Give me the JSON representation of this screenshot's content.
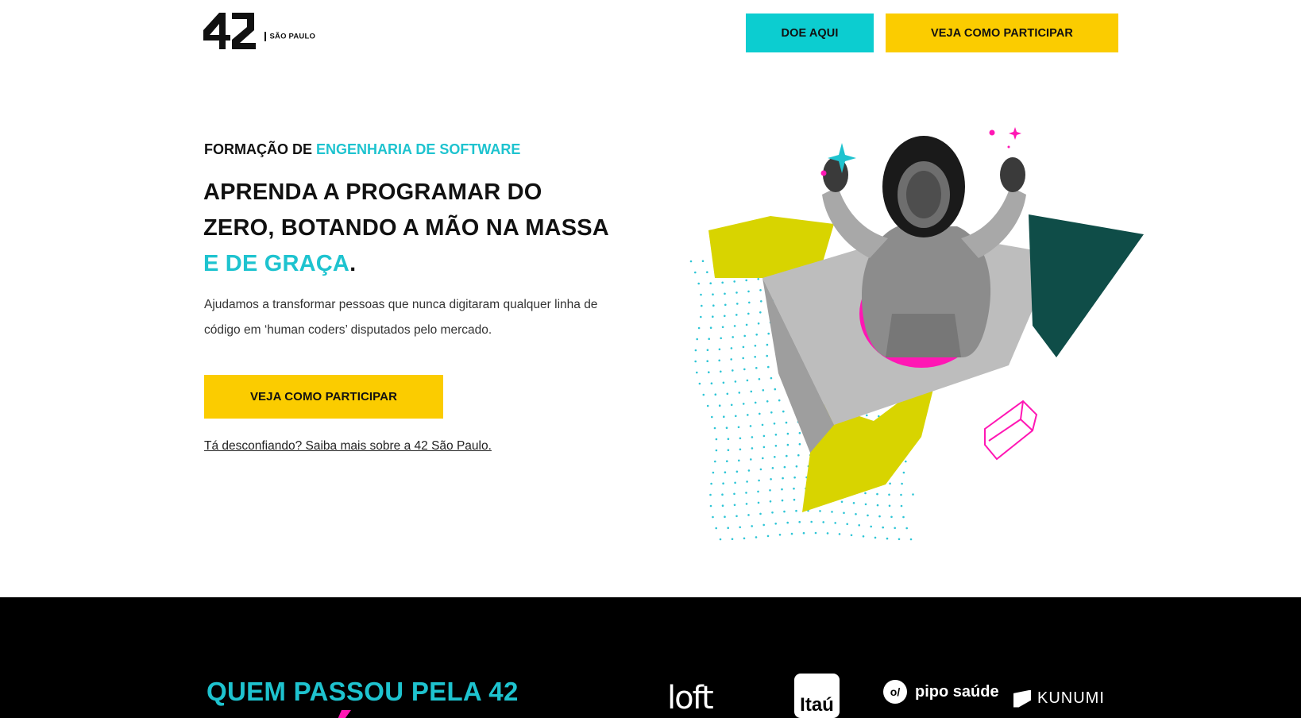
{
  "header": {
    "logo_number": "42",
    "logo_subtitle": "SÃO PAULO",
    "donate_label": "DOE AQUI",
    "participate_label": "VEJA COMO PARTICIPAR"
  },
  "hero": {
    "kicker_prefix": "FORMAÇÃO DE",
    "kicker_accent": "ENGENHARIA DE SOFTWARE",
    "title_main": "APRENDA A PROGRAMAR DO ZERO, BOTANDO A MÃO NA MASSA",
    "title_accent": "E DE GRAÇA",
    "title_end": ".",
    "description": "Ajudamos a transformar pessoas que nunca digitaram qualquer linha de código em ‘human coders’ disputados pelo mercado.",
    "cta_label": "VEJA COMO PARTICIPAR",
    "link_text": "Tá desconfiando? Saiba mais sobre a 42 São Paulo."
  },
  "band": {
    "title": "QUEM PASSOU PELA 42",
    "partners": [
      "loft",
      "Itaú",
      "pipo saúde",
      "KUNUMI"
    ]
  },
  "colors": {
    "accent_cyan": "#1ec3cf",
    "button_cyan": "#0ccdd0",
    "button_yellow": "#fbcc00",
    "magenta": "#ff17b4",
    "band_black": "#000000"
  },
  "icons": {
    "logo": "42-logo-icon",
    "pipo": "pipo-saude-logo-icon",
    "kunumi": "kunumi-logo-icon"
  }
}
